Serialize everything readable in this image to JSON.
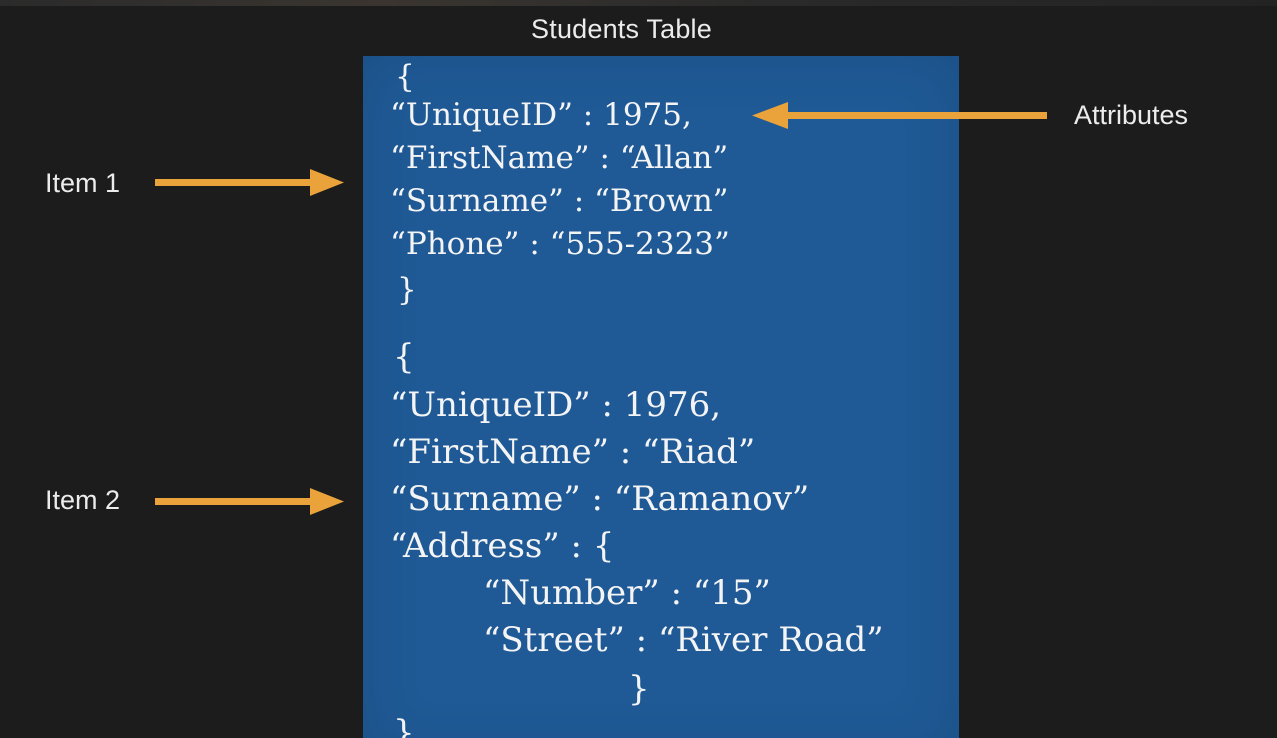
{
  "title": "Students Table",
  "labels": {
    "item1": "Item 1",
    "item2": "Item 2",
    "attributes": "Attributes"
  },
  "colors": {
    "background": "#1c1c1c",
    "card": "#1f5a96",
    "arrow": "#e9a33a",
    "text": "#ececec"
  },
  "item1": {
    "open": "{",
    "lines": [
      "“UniqueID” : 1975,",
      "“FirstName” : “Allan”",
      "“Surname” : “Brown”",
      "“Phone” : “555-2323”"
    ],
    "close": "}"
  },
  "item2": {
    "open": "{",
    "lines": [
      "“UniqueID” : 1976,",
      "“FirstName” : “Riad”",
      "“Surname” : “Ramanov”",
      "“Address” : {"
    ],
    "address_lines": [
      "“Number” : “15”",
      "“Street” : “River Road”"
    ],
    "address_close": "}",
    "close": "}"
  }
}
